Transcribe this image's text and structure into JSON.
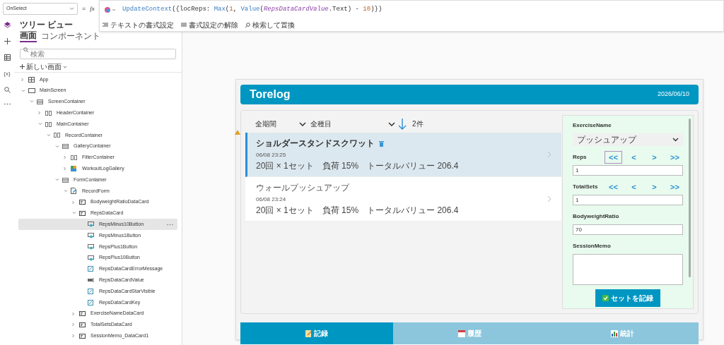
{
  "property": {
    "value": "OnSelect",
    "equals": "=",
    "fx": "fx"
  },
  "rail": {
    "variables": "{x}"
  },
  "formula": {
    "tokens": [
      {
        "text": "UpdateContext",
        "kind": "function"
      },
      {
        "text": "({locReps: ",
        "kind": "plain"
      },
      {
        "text": "Max",
        "kind": "function"
      },
      {
        "text": "(",
        "kind": "plain"
      },
      {
        "text": "1",
        "kind": "number"
      },
      {
        "text": ", ",
        "kind": "plain"
      },
      {
        "text": "Value",
        "kind": "function"
      },
      {
        "text": "(",
        "kind": "plain"
      },
      {
        "text": "RepsDataCardValue",
        "kind": "control"
      },
      {
        "text": ".Text) - ",
        "kind": "plain"
      },
      {
        "text": "10",
        "kind": "number"
      },
      {
        "text": ")})",
        "kind": "plain"
      }
    ],
    "toolbar": [
      "テキストの書式設定",
      "書式設定の解除",
      "検索して置換"
    ]
  },
  "tree_panel": {
    "title": "ツリー ビュー",
    "tabs": [
      {
        "label": "画面",
        "selected": true
      },
      {
        "label": "コンポーネント",
        "selected": false
      }
    ],
    "search": {
      "placeholder": "検索"
    },
    "new_screen": "新しい画面",
    "items": [
      {
        "label": "App",
        "kind": "app",
        "expanded": false,
        "selected": false
      },
      {
        "label": "MainScreen",
        "kind": "screen",
        "expanded": true,
        "selected": false,
        "children": [
          {
            "label": "ScreenContainer",
            "kind": "container_v",
            "expanded": true,
            "selected": false,
            "children": [
              {
                "label": "HeaderContainer",
                "kind": "container_h",
                "expanded": false,
                "selected": false
              },
              {
                "label": "MainContainer",
                "kind": "container_h",
                "expanded": true,
                "selected": false,
                "children": [
                  {
                    "label": "RecordContainer",
                    "kind": "container_h",
                    "expanded": true,
                    "selected": false,
                    "children": [
                      {
                        "label": "GalleryContainer",
                        "kind": "container_v",
                        "expanded": true,
                        "selected": false,
                        "children": [
                          {
                            "label": "FilterContainer",
                            "kind": "container_h",
                            "expanded": false,
                            "selected": false
                          },
                          {
                            "label": "WorkoutLogGallery",
                            "kind": "gallery",
                            "expanded": false,
                            "selected": false
                          }
                        ]
                      },
                      {
                        "label": "FormContainer",
                        "kind": "container_v",
                        "expanded": true,
                        "selected": false,
                        "children": [
                          {
                            "label": "RecordForm",
                            "kind": "form",
                            "expanded": true,
                            "selected": false,
                            "children": [
                              {
                                "label": "BodyweightRatioDataCard",
                                "kind": "card",
                                "expanded": false,
                                "selected": false
                              },
                              {
                                "label": "RepsDataCard",
                                "kind": "card",
                                "expanded": true,
                                "selected": false,
                                "children": [
                                  {
                                    "label": "RepsMinus10Button",
                                    "kind": "button",
                                    "selected": true
                                  },
                                  {
                                    "label": "RepsMinus1Button",
                                    "kind": "button",
                                    "selected": false
                                  },
                                  {
                                    "label": "RepsPlus1Button",
                                    "kind": "button",
                                    "selected": false
                                  },
                                  {
                                    "label": "RepsPlus10Button",
                                    "kind": "button",
                                    "selected": false
                                  },
                                  {
                                    "label": "RepsDataCardErrorMessage",
                                    "kind": "label",
                                    "selected": false
                                  },
                                  {
                                    "label": "RepsDataCardValue",
                                    "kind": "input",
                                    "selected": false
                                  },
                                  {
                                    "label": "RepsDataCardStarVisible",
                                    "kind": "label",
                                    "selected": false
                                  },
                                  {
                                    "label": "RepsDataCardKey",
                                    "kind": "label",
                                    "selected": false
                                  }
                                ]
                              },
                              {
                                "label": "ExerciseNameDataCard",
                                "kind": "card",
                                "expanded": false,
                                "selected": false
                              },
                              {
                                "label": "TotalSetsDataCard",
                                "kind": "card",
                                "expanded": false,
                                "selected": false
                              },
                              {
                                "label": "SessionMemo_DataCard1",
                                "kind": "card",
                                "expanded": false,
                                "selected": false
                              }
                            ]
                          }
                        ]
                      }
                    ]
                  }
                ]
              }
            ]
          }
        ]
      }
    ]
  },
  "app": {
    "title": "Torelog",
    "date": "2026/06/10",
    "filters": [
      {
        "value": "全期間"
      },
      {
        "value": "全種目"
      }
    ],
    "count": "2件",
    "records": [
      {
        "title": "ショルダースタンドスクワット",
        "date": "06/08 23:25",
        "detail": "20回 × 1セット　負荷 15%　トータルバリュー 206.4",
        "selected": true
      },
      {
        "title": "ウォールプッシュアップ",
        "date": "06/08 23:24",
        "detail": "20回 × 1セット　負荷 15%　トータルバリュー 206.4",
        "selected": false
      }
    ],
    "form": [
      {
        "kind": "dropdown",
        "label": "ExerciseName",
        "value": "プッシュアップ"
      },
      {
        "kind": "stepper",
        "label": "Reps",
        "value": "1",
        "buttons": [
          {
            "label": "<<",
            "selected": true
          },
          {
            "label": "<",
            "selected": false
          },
          {
            "label": ">",
            "selected": false
          },
          {
            "label": ">>",
            "selected": false
          }
        ]
      },
      {
        "kind": "stepper",
        "label": "TotalSets",
        "value": "1",
        "buttons": [
          {
            "label": "<<",
            "selected": false
          },
          {
            "label": "<",
            "selected": false
          },
          {
            "label": ">",
            "selected": false
          },
          {
            "label": ">>",
            "selected": false
          }
        ]
      },
      {
        "kind": "text",
        "label": "BodyweightRatio",
        "value": "70"
      },
      {
        "kind": "memo",
        "label": "SessionMemo"
      }
    ],
    "submit": "セットを記録",
    "nav": [
      {
        "label": "記録",
        "kind": "memo",
        "selected": true
      },
      {
        "label": "履歴",
        "kind": "calendar",
        "selected": false
      },
      {
        "label": "統計",
        "kind": "chart",
        "selected": false
      }
    ]
  }
}
